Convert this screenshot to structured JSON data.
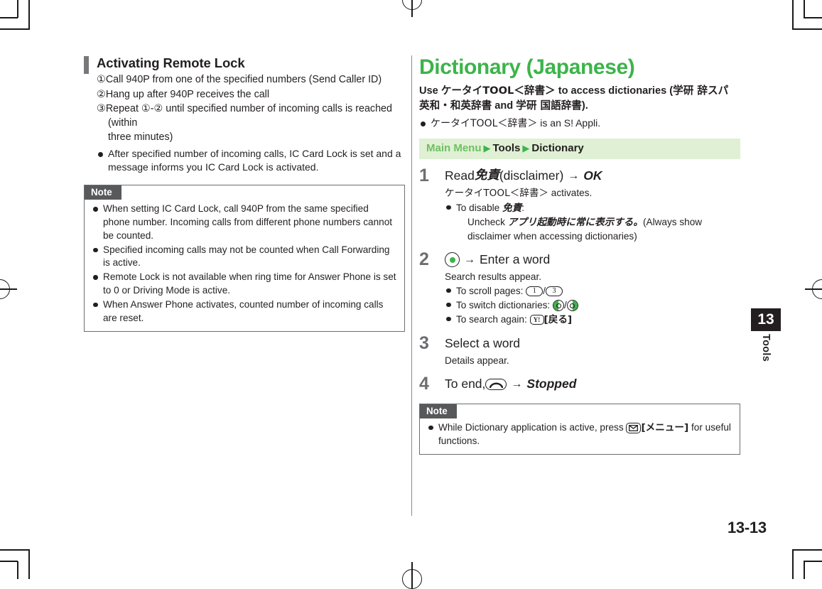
{
  "page": {
    "folio": "13-13",
    "chapter_number": "13",
    "chapter_label": "Tools"
  },
  "left_column": {
    "section_heading": "Activating Remote Lock",
    "numbered_steps": [
      "①Call 940P from one of the specified numbers (Send Caller ID)",
      "②Hang up after 940P receives the call",
      "③Repeat ①-② until specified number of incoming calls is reached (within",
      "three minutes)"
    ],
    "bullets": [
      "After specified number of incoming calls, IC Card Lock is set and a message informs you IC Card Lock is activated."
    ],
    "note": {
      "label": "Note",
      "bullets": [
        "When setting IC Card Lock, call 940P from the same specified phone number.  Incoming calls from different phone numbers cannot be counted.",
        "Specified incoming calls may not be counted when Call Forwarding is active.",
        "Remote Lock is not available when ring time for Answer Phone is set to 0 or Driving Mode is active.",
        "When Answer Phone activates, counted number of incoming calls are reset."
      ]
    }
  },
  "right_column": {
    "title": "Dictionary (Japanese)",
    "lede_line1_a": "Use ",
    "lede_line1_jp": "ケータイTOOL＜辞書＞",
    "lede_line1_b": " to access dictionaries (",
    "lede_line1_jp2": "学研 辞スパ",
    "lede_line2_jp": "英和・和英辞書",
    "lede_line2_a": " and ",
    "lede_line2_jp2": "学研 国語辞書",
    "lede_line2_b": ").",
    "lede_bullet_jp": "ケータイTOOL＜辞書＞",
    "lede_bullet_text": " is an S! Appli.",
    "navbar": {
      "main_menu": "Main Menu",
      "triangle": "▶",
      "tools": "Tools",
      "dictionary": "Dictionary"
    },
    "steps": [
      {
        "num": "1",
        "head_pre": "Read ",
        "head_jp": "免責",
        "head_mid": " (disclaimer)",
        "head_arrow": "→",
        "head_result": "OK",
        "body_line1_jp": "ケータイTOOL＜辞書＞",
        "body_line1_text": " activates.",
        "bullet_pre": "To disable ",
        "bullet_jp": "免責",
        "bullet_post": ":",
        "sub_pre": "Uncheck ",
        "sub_jp": "アプリ起動時に常に表示する。",
        "sub_post": "(Always show",
        "sub_line2": "disclaimer when accessing dictionaries)"
      },
      {
        "num": "2",
        "key_icon": "center-select-key-icon",
        "head_arrow": "→",
        "head_text": "Enter a word",
        "body_line1": "Search results appear.",
        "bullet_scroll_label": "To scroll pages: ",
        "key_1": "1",
        "key_sep": "/",
        "key_3": "3",
        "bullet_switch_label": "To switch dictionaries: ",
        "bullet_search_label": "To search again: ",
        "key_y_label": "Y!",
        "key_y_bracket": "[戻る]"
      },
      {
        "num": "3",
        "head_text": "Select a word",
        "body_line1": "Details appear."
      },
      {
        "num": "4",
        "head_pre": "To end, ",
        "key_icon": "end-call-key-icon",
        "head_arrow": "→",
        "head_result": "Stopped"
      }
    ],
    "note": {
      "label": "Note",
      "bullet_pre": "While Dictionary application is active, press ",
      "key_icon": "mail-key-icon",
      "bullet_bracket": "[メニュー]",
      "bullet_post": " for useful functions."
    }
  },
  "colors": {
    "accent_green": "#3cb44a",
    "navbar_bg": "#dff0d4",
    "navbar_green_text": "#6ec060",
    "note_tab_bg": "#58595b",
    "section_bar": "#77787b",
    "step_number": "#6d6e71",
    "text": "#231f20"
  }
}
